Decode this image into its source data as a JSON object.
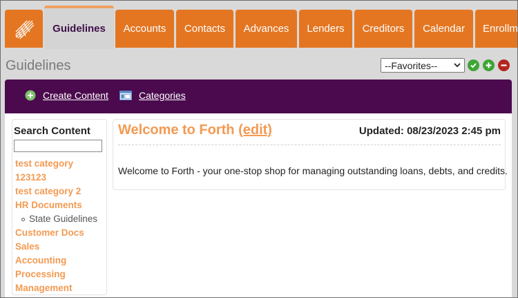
{
  "tabs": [
    {
      "label": "Guidelines",
      "active": true
    },
    {
      "label": "Accounts"
    },
    {
      "label": "Contacts"
    },
    {
      "label": "Advances"
    },
    {
      "label": "Lenders"
    },
    {
      "label": "Creditors"
    },
    {
      "label": "Calendar"
    },
    {
      "label": "Enrollm"
    }
  ],
  "header": {
    "title": "Guidelines",
    "favorites_value": "--Favorites--"
  },
  "toolbar": {
    "create_label": "Create Content",
    "categories_label": "Categories"
  },
  "sidebar": {
    "title": "Search Content",
    "search_value": "",
    "categories": [
      "test category",
      "123123",
      "test category 2",
      "HR Documents",
      "State Guidelines",
      "Customer Docs",
      "Sales",
      "Accounting",
      "Processing",
      "Management"
    ]
  },
  "main": {
    "title": "Welcome to Forth",
    "edit_label": "(edit)",
    "updated": "Updated: 08/23/2023 2:45 pm",
    "body": "Welcome to Forth - your one-stop shop for managing outstanding loans, debts, and credits."
  },
  "colors": {
    "tab_orange": "#e47622",
    "toolbar_purple": "#4a0a4d",
    "link_orange": "#f39a52",
    "confirm_green": "#3fa535",
    "add_green": "#3fa535",
    "remove_red": "#b3261e"
  },
  "icons": [
    "logo-icon",
    "chevron-down-icon",
    "check-icon",
    "plus-icon",
    "minus-icon",
    "add-content-icon",
    "categories-icon"
  ]
}
